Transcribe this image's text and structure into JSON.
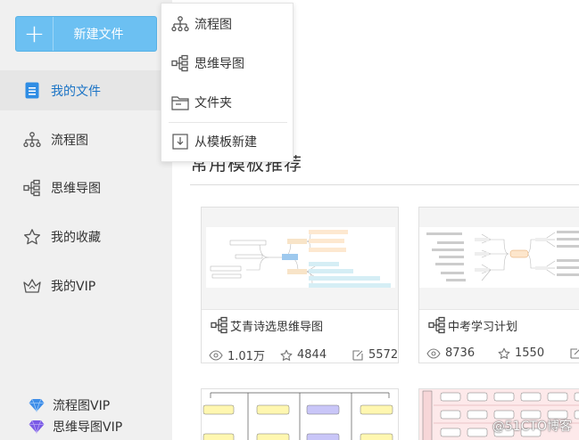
{
  "sidebar": {
    "new_file_label": "新建文件",
    "plus_symbol": "+",
    "items": [
      {
        "label": "我的文件",
        "icon": "file-icon",
        "active": true
      },
      {
        "label": "流程图",
        "icon": "flowchart-icon",
        "active": false
      },
      {
        "label": "思维导图",
        "icon": "mindmap-icon",
        "active": false
      },
      {
        "label": "我的收藏",
        "icon": "star-icon",
        "active": false
      },
      {
        "label": "我的VIP",
        "icon": "crown-icon",
        "active": false
      }
    ],
    "vip": [
      {
        "label": "流程图VIP",
        "icon": "diamond-blue-icon"
      },
      {
        "label": "思维导图VIP",
        "icon": "diamond-purple-icon"
      }
    ]
  },
  "dropdown": {
    "items": [
      {
        "label": "流程图",
        "icon": "flowchart-icon"
      },
      {
        "label": "思维导图",
        "icon": "mindmap-icon"
      },
      {
        "label": "文件夹",
        "icon": "folder-icon"
      },
      {
        "label": "从模板新建",
        "icon": "template-import-icon"
      }
    ]
  },
  "main": {
    "section_title": "常用模板推荐",
    "cards": [
      {
        "title": "艾青诗选思维导图",
        "views": "1.01万",
        "likes": "4844",
        "edits": "5572"
      },
      {
        "title": "中考学习计划",
        "views": "8736",
        "likes": "1550",
        "edits": ""
      }
    ]
  },
  "colors": {
    "accent": "#6cc0f2",
    "active_text": "#1a73c5",
    "sidebar_bg": "#f0f0f0"
  },
  "watermark": "@51CTO博客"
}
